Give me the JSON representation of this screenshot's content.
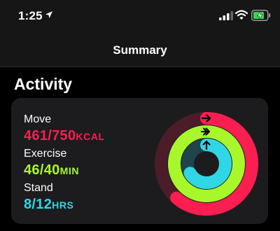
{
  "status_bar": {
    "time": "1:25"
  },
  "nav": {
    "title": "Summary"
  },
  "section": {
    "title": "Activity"
  },
  "metrics": {
    "move": {
      "label": "Move",
      "value": "461/750",
      "unit": "KCAL",
      "current": 461,
      "goal": 750,
      "color": "#fa1e51"
    },
    "exercise": {
      "label": "Exercise",
      "value": "46/40",
      "unit": "MIN",
      "current": 46,
      "goal": 40,
      "color": "#a7f72b"
    },
    "stand": {
      "label": "Stand",
      "value": "8/12",
      "unit": "HRS",
      "current": 8,
      "goal": 12,
      "color": "#2fd7e5"
    }
  },
  "icons": {
    "location": "location-arrow-icon",
    "signal": "cellular-signal-icon",
    "wifi": "wifi-icon",
    "battery": "battery-charging-icon",
    "ring_arrow": "ring-arrow-icon"
  }
}
